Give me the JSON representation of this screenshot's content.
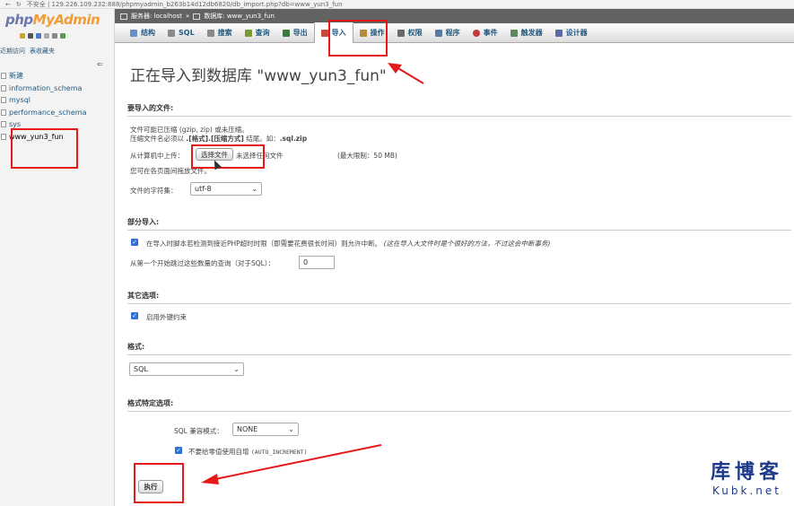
{
  "browser": {
    "url": "不安全 | 129.226.109.232:888/phpmyadmin_b263b14d12db6820/db_import.php?db=www_yun3_fun"
  },
  "sidebar": {
    "logo_part1": "php",
    "logo_part2": "MyAdmin",
    "recent": "近期访问",
    "favorites": "表收藏夹",
    "collapse": "⇐",
    "items": [
      {
        "label": "新建"
      },
      {
        "label": "information_schema"
      },
      {
        "label": "mysql"
      },
      {
        "label": "performance_schema"
      },
      {
        "label": "sys"
      },
      {
        "label": "www_yun3_fun"
      }
    ]
  },
  "breadcrumb": {
    "server": "服务器: localhost",
    "sep": "»",
    "database": "数据库: www_yun3_fun"
  },
  "tabs": [
    {
      "label": "结构",
      "icon_color": "#6a8fc4"
    },
    {
      "label": "SQL",
      "icon_color": "#8a8a8a"
    },
    {
      "label": "搜索",
      "icon_color": "#8a8a8a"
    },
    {
      "label": "查询",
      "icon_color": "#7a9a3a"
    },
    {
      "label": "导出",
      "icon_color": "#3a7a3a"
    },
    {
      "label": "导入",
      "icon_color": "#c44a3a"
    },
    {
      "label": "操作",
      "icon_color": "#b58a3a"
    },
    {
      "label": "权限",
      "icon_color": "#6a6a6a"
    },
    {
      "label": "程序",
      "icon_color": "#5a7aa4"
    },
    {
      "label": "事件",
      "icon_color": "#c43a3a"
    },
    {
      "label": "触发器",
      "icon_color": "#5a8a5a"
    },
    {
      "label": "设计器",
      "icon_color": "#5a6aa4"
    }
  ],
  "main": {
    "title": "正在导入到数据库 \"www_yun3_fun\"",
    "file_section": {
      "heading": "要导入的文件:",
      "line1": "文件可能已压缩 (gzip, zip) 或未压缩。",
      "line2_a": "压缩文件名必须以 ",
      "line2_b": ".[格式].[压缩方式]",
      "line2_c": " 结尾。如：",
      "line2_d": ".sql.zip",
      "upload_label": "从计算机中上传：",
      "choose_button": "选择文件",
      "no_file": "未选择任何文件",
      "max_limit": "(最大限制：50 MB)",
      "drag_hint": "您可在各页面间拖放文件。",
      "charset_label": "文件的字符集：",
      "charset_value": "utf-8"
    },
    "partial_section": {
      "heading": "部分导入:",
      "allow_interrupt": "在导入时脚本若检测到接近PHP超时时限（即需要花费很长时间）则允许中断。",
      "allow_interrupt_note": "(这在导入大文件时是个很好的方法，不过这会中断事务)",
      "skip_label": "从第一个开始跳过这些数量的查询（对于SQL）：",
      "skip_value": "0"
    },
    "other_section": {
      "heading": "其它选项:",
      "foreign_keys": "启用外键约束"
    },
    "format_section": {
      "heading": "格式:",
      "format_value": "SQL"
    },
    "format_specific": {
      "heading": "格式特定选项:",
      "compat_label": "SQL 兼容模式：",
      "compat_value": "NONE",
      "no_auto_value": "不要给零值使用自增",
      "no_auto_value_code": "(AUTO_INCREMENT)"
    },
    "go_button": "执行"
  },
  "watermark": {
    "line1": "库博客",
    "line2": "Kubk.net"
  }
}
